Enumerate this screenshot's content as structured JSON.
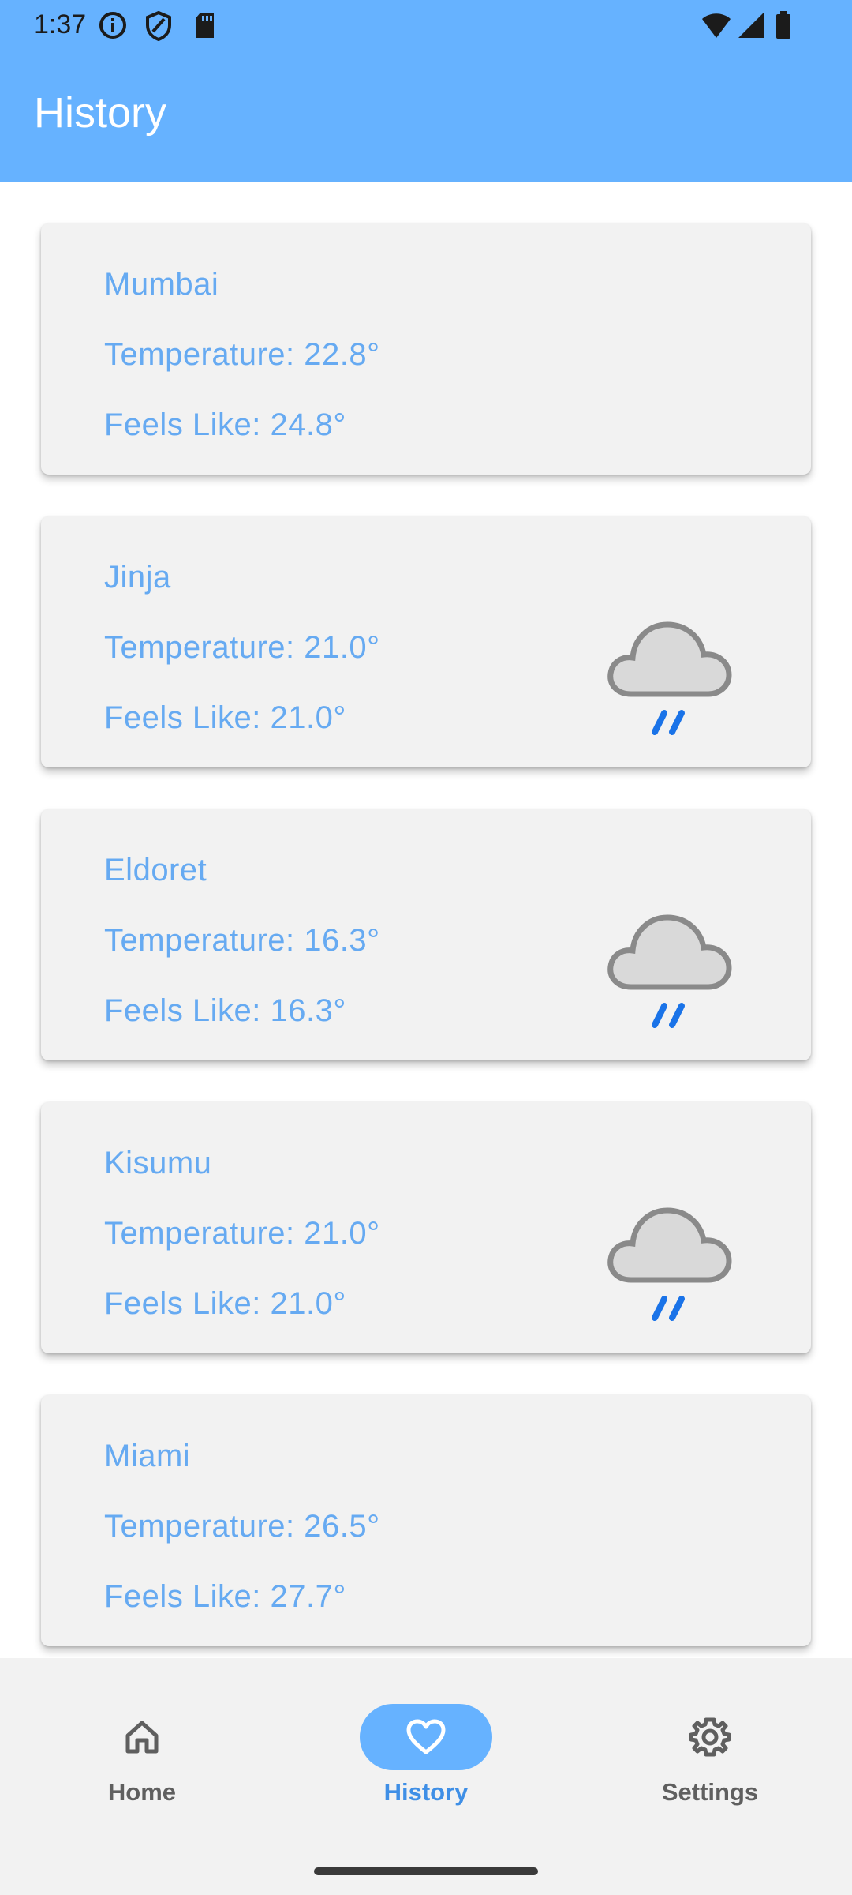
{
  "status_bar": {
    "time": "1:37",
    "icons": [
      "info-icon",
      "shield-icon",
      "sd-card-icon",
      "wifi-icon",
      "signal-icon",
      "battery-icon"
    ]
  },
  "app_bar": {
    "title": "History"
  },
  "colors": {
    "primary": "#66b2ff",
    "card_bg": "#f2f2f2",
    "card_text": "#66aaf2",
    "moon": "#0a6ed8",
    "cloud": "#d9d9d9",
    "rain": "#1a73e8"
  },
  "history": [
    {
      "city": "Mumbai",
      "temperature": "Temperature: 22.8°",
      "feels_like": "Feels Like: 24.8°",
      "icon": "moon-icon"
    },
    {
      "city": "Jinja",
      "temperature": "Temperature: 21.0°",
      "feels_like": "Feels Like: 21.0°",
      "icon": "night-rain-cloud-icon"
    },
    {
      "city": "Eldoret",
      "temperature": "Temperature: 16.3°",
      "feels_like": "Feels Like: 16.3°",
      "icon": "night-rain-cloud-icon"
    },
    {
      "city": "Kisumu",
      "temperature": "Temperature: 21.0°",
      "feels_like": "Feels Like: 21.0°",
      "icon": "night-rain-cloud-icon"
    },
    {
      "city": "Miami",
      "temperature": "Temperature: 26.5°",
      "feels_like": "Feels Like: 27.7°",
      "icon": "moon-icon"
    }
  ],
  "bottom_nav": {
    "items": [
      {
        "label": "Home",
        "icon": "home-icon",
        "active": false
      },
      {
        "label": "History",
        "icon": "heart-icon",
        "active": true
      },
      {
        "label": "Settings",
        "icon": "gear-icon",
        "active": false
      }
    ]
  }
}
